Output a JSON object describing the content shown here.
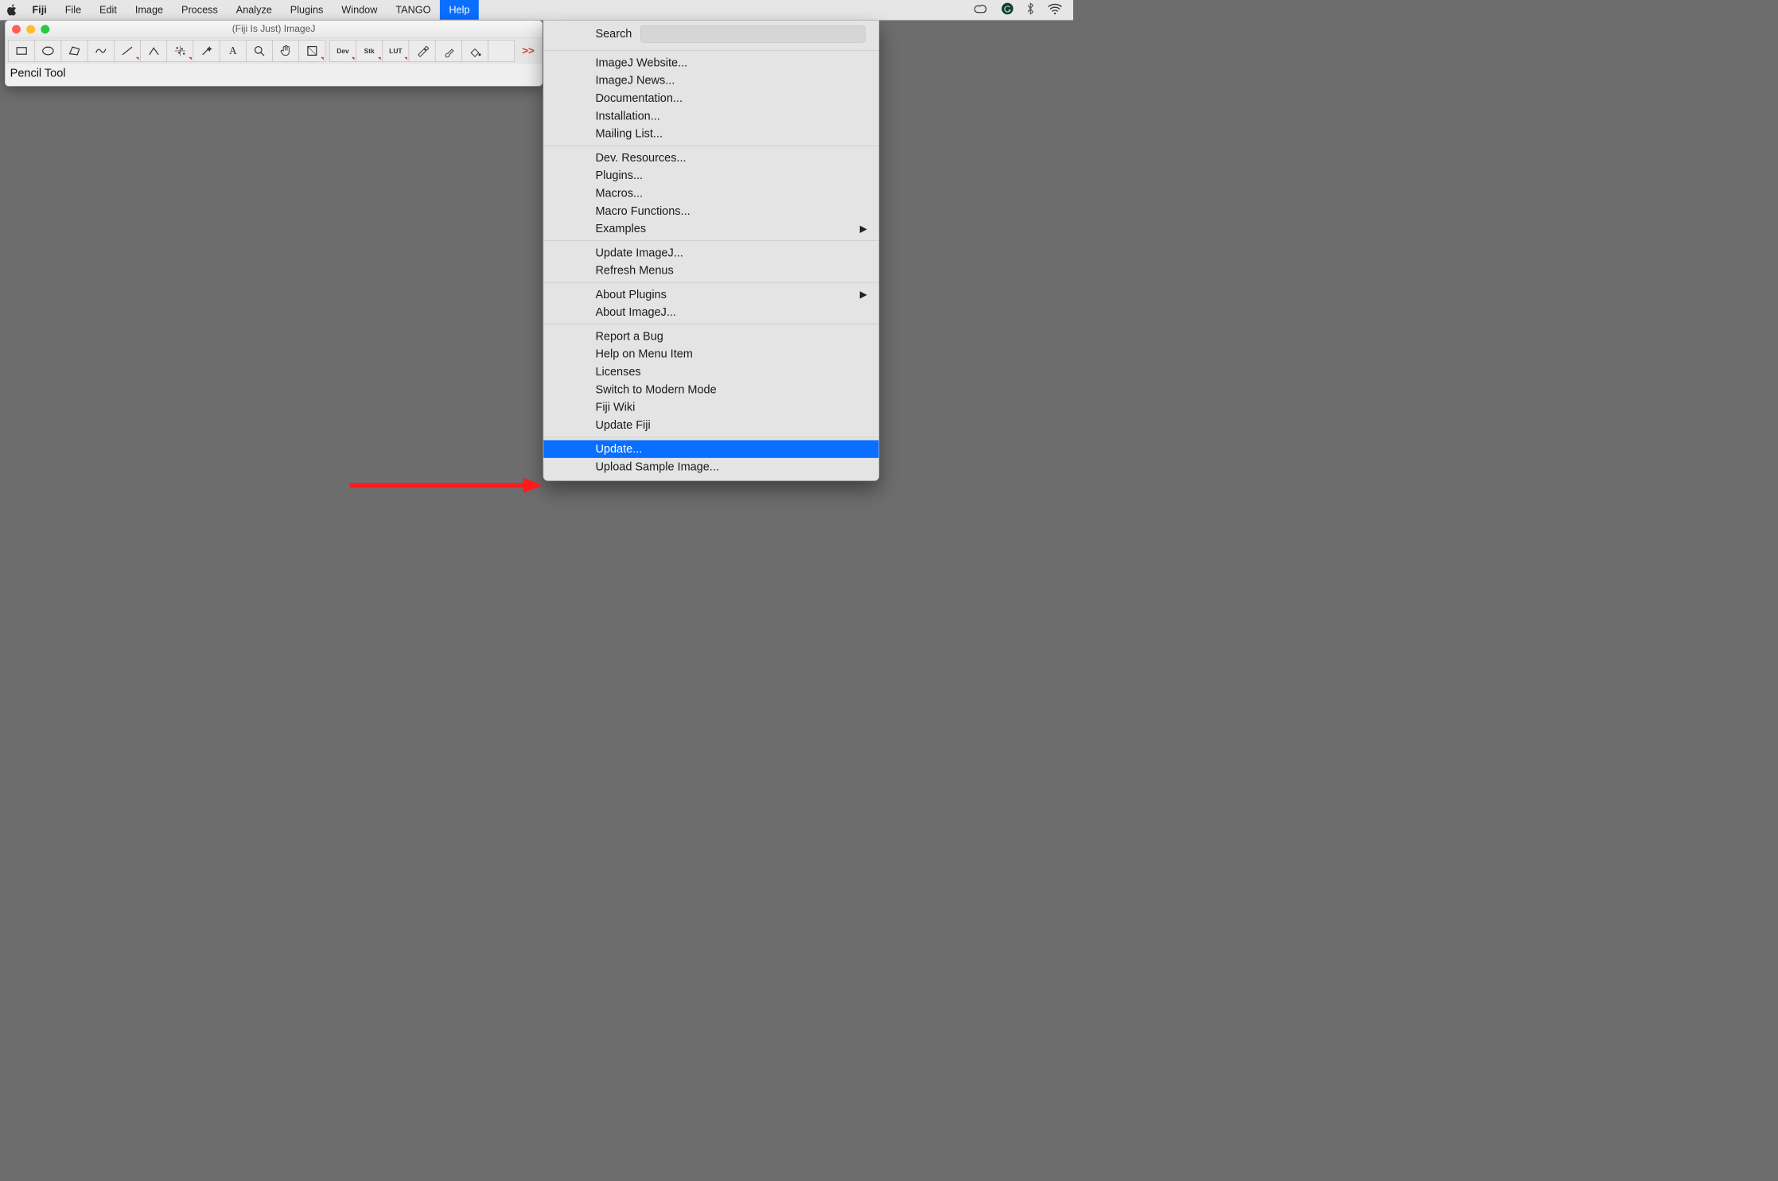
{
  "menubar": {
    "app_name": "Fiji",
    "items": [
      "File",
      "Edit",
      "Image",
      "Process",
      "Analyze",
      "Plugins",
      "Window",
      "TANGO",
      "Help"
    ],
    "open_index": 8
  },
  "tray_icons": [
    "creative-cloud-icon",
    "grammarly-icon",
    "bluetooth-icon",
    "wifi-icon"
  ],
  "imagej": {
    "title": "(Fiji Is Just) ImageJ",
    "status": "Pencil Tool",
    "tools": [
      {
        "name": "rectangle-tool",
        "type": "svg"
      },
      {
        "name": "oval-tool",
        "type": "svg"
      },
      {
        "name": "polygon-tool",
        "type": "svg"
      },
      {
        "name": "freehand-tool",
        "type": "svg"
      },
      {
        "name": "line-tool",
        "type": "svg",
        "tri": true
      },
      {
        "name": "angle-tool",
        "type": "svg"
      },
      {
        "name": "multipoint-tool",
        "type": "svg",
        "tri": true
      },
      {
        "name": "wand-tool",
        "type": "svg"
      },
      {
        "name": "text-tool",
        "type": "text",
        "label": "A",
        "class": "text"
      },
      {
        "name": "magnify-tool",
        "type": "svg"
      },
      {
        "name": "hand-tool",
        "type": "svg"
      },
      {
        "name": "color-picker-tool",
        "type": "svg",
        "tri": true
      },
      {
        "name": "gap",
        "type": "gap"
      },
      {
        "name": "dev-tool",
        "type": "text",
        "label": "Dev",
        "class": "small-text",
        "tri": true
      },
      {
        "name": "stacks-tool",
        "type": "text",
        "label": "Stk",
        "class": "small-text",
        "tri": true
      },
      {
        "name": "lut-tool",
        "type": "text",
        "label": "LUT",
        "class": "small-text",
        "tri": true
      },
      {
        "name": "pencil-tool",
        "type": "svg"
      },
      {
        "name": "paintbrush-tool",
        "type": "svg"
      },
      {
        "name": "flood-fill-tool",
        "type": "svg"
      },
      {
        "name": "empty-tool",
        "type": "text",
        "label": ""
      },
      {
        "name": "gap",
        "type": "gap"
      },
      {
        "name": "more-tools",
        "type": "more",
        "label": ">>"
      }
    ]
  },
  "help_menu": {
    "search_label": "Search",
    "search_value": "",
    "groups": [
      [
        {
          "label": "ImageJ Website..."
        },
        {
          "label": "ImageJ News..."
        },
        {
          "label": "Documentation..."
        },
        {
          "label": "Installation..."
        },
        {
          "label": "Mailing List..."
        }
      ],
      [
        {
          "label": "Dev. Resources..."
        },
        {
          "label": "Plugins..."
        },
        {
          "label": "Macros..."
        },
        {
          "label": "Macro Functions..."
        },
        {
          "label": "Examples",
          "submenu": true
        }
      ],
      [
        {
          "label": "Update ImageJ..."
        },
        {
          "label": "Refresh Menus"
        }
      ],
      [
        {
          "label": "About Plugins",
          "submenu": true
        },
        {
          "label": "About ImageJ..."
        }
      ],
      [
        {
          "label": "Report a Bug"
        },
        {
          "label": "Help on Menu Item"
        },
        {
          "label": "Licenses"
        },
        {
          "label": "Switch to Modern Mode"
        },
        {
          "label": "Fiji Wiki"
        },
        {
          "label": "Update Fiji"
        }
      ],
      [
        {
          "label": "Update...",
          "highlight": true
        },
        {
          "label": "Upload Sample Image..."
        }
      ]
    ]
  },
  "annotation": {
    "type": "red-arrow",
    "points_to": "help-menu-item-update"
  }
}
